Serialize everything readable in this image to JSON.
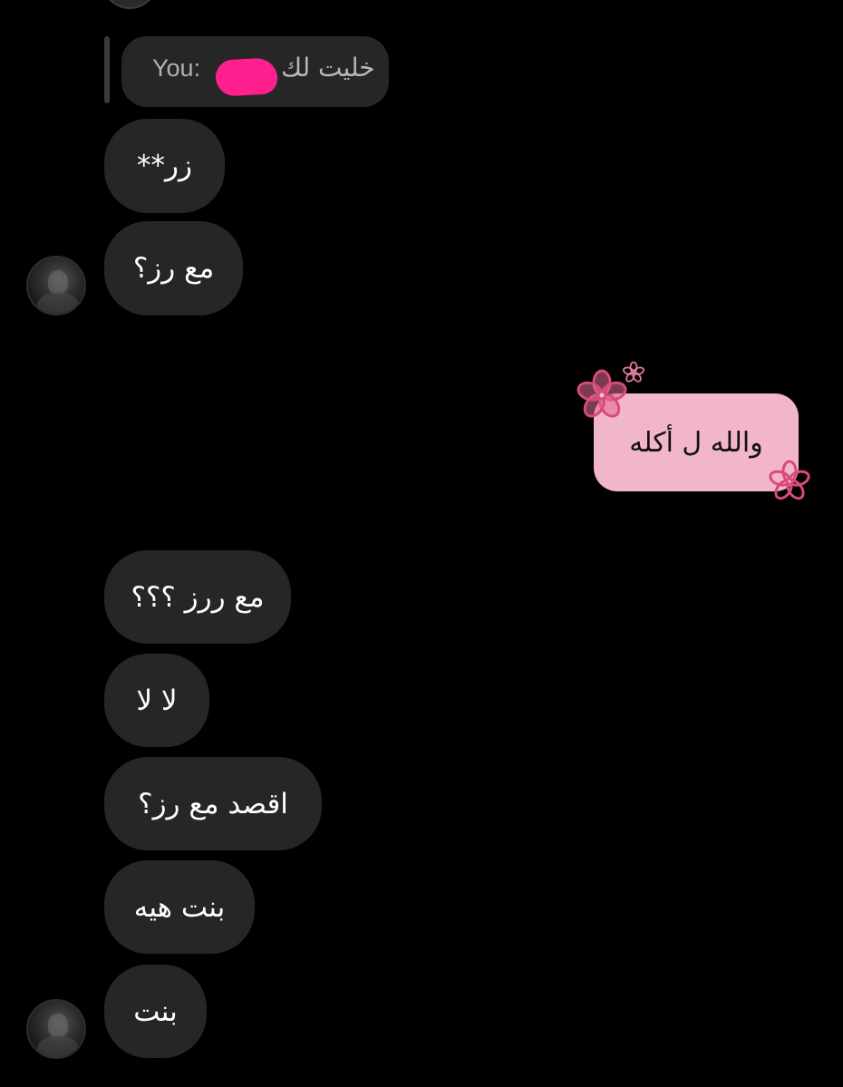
{
  "colors": {
    "background": "#000000",
    "received_bubble": "#262626",
    "sent_bubble": "#f2b6cc",
    "redaction": "#ff1f8f",
    "flower": "#d94a7a"
  },
  "reply": {
    "prefix": "You:",
    "text": "خليت لك",
    "redacted": true
  },
  "messages": [
    {
      "text": "زر**"
    },
    {
      "text": "مع رز؟"
    },
    {
      "text": "مع ررز ؟؟؟"
    },
    {
      "text": "لا لا"
    },
    {
      "text": "اقصد مع رز؟"
    },
    {
      "text": "بنت هيه"
    },
    {
      "text": "بنت"
    }
  ],
  "sent": {
    "text": "والله ل أكله",
    "decoration": "flower-icon"
  },
  "avatars": [
    "avatar",
    "avatar"
  ]
}
